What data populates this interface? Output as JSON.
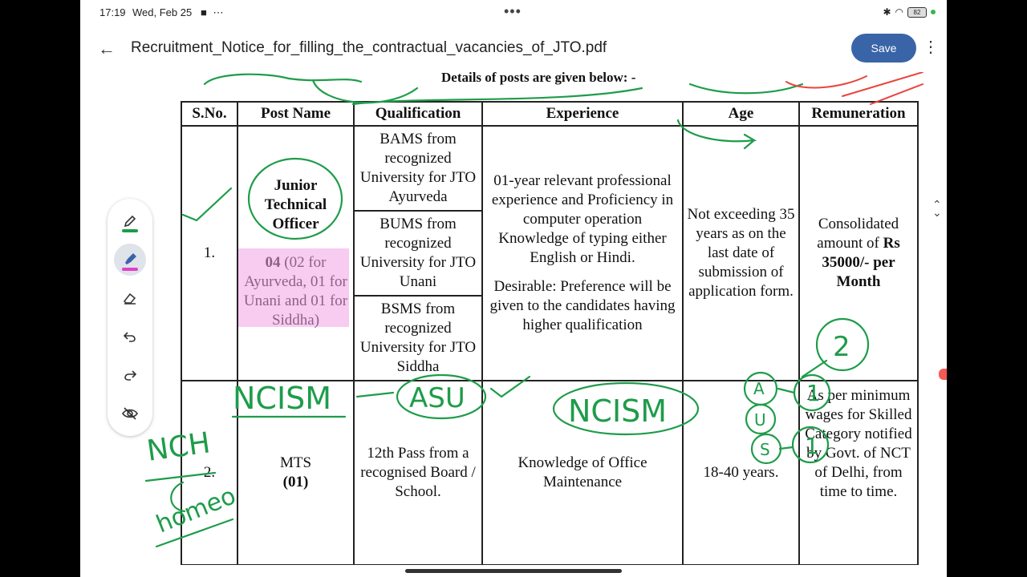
{
  "status_bar": {
    "time": "17:19",
    "date": "Wed, Feb 25",
    "battery": "82"
  },
  "app_bar": {
    "file_name": "Recruitment_Notice_for_filling_the_contractual_vacancies_of_JTO.pdf",
    "save_label": "Save"
  },
  "document": {
    "heading": "Details of posts are given below: -",
    "table": {
      "headers": [
        "S.No.",
        "Post Name",
        "Qualification",
        "Experience",
        "Age",
        "Remuneration"
      ],
      "rows": [
        {
          "sno": "1.",
          "post_title": "Junior Technical Officer",
          "post_count_bold": "04",
          "post_count_detail": " (02 for Ayurveda, 01 for Unani and 01 for Siddha)",
          "qualifications": [
            "BAMS from recognized University for JTO Ayurveda",
            "BUMS from recognized University for JTO Unani",
            "BSMS from recognized University for JTO Siddha"
          ],
          "experience": "01-year relevant professional experience and Proficiency in computer operation Knowledge of typing either English or Hindi.",
          "experience_desirable": "Desirable: Preference will be given to the candidates having higher qualification",
          "age": "Not exceeding 35 years as on the last date of submission of application form.",
          "remuneration_prefix": "Consolidated amount of ",
          "remuneration_bold": "Rs 35000/- per Month"
        },
        {
          "sno": "2.",
          "post_title": "MTS",
          "post_count": "(01)",
          "qualification": "12th Pass from a recognised Board / School.",
          "experience": "Knowledge of Office Maintenance",
          "age": "18-40 years.",
          "remuneration": "As per minimum wages for Skilled Category notified by Govt. of NCT of Delhi, from time to time."
        }
      ]
    },
    "handwriting": {
      "ncism_left": "NCISM",
      "asu": "ASU",
      "ncism_center": "NCISM",
      "nch": "NCH",
      "homeo": "homeo",
      "circle_two": "2",
      "circle_a": "A",
      "circle_u": "U",
      "circle_s": "S",
      "one_top": "1",
      "one_bottom": "1"
    }
  },
  "pen_toolbar": {
    "tools": [
      "pen-icon",
      "highlighter-icon",
      "eraser-icon",
      "undo-icon",
      "redo-icon",
      "hide-annotations-icon"
    ],
    "pen_color": "#1e9c4a",
    "highlighter_color": "#e040c8"
  }
}
